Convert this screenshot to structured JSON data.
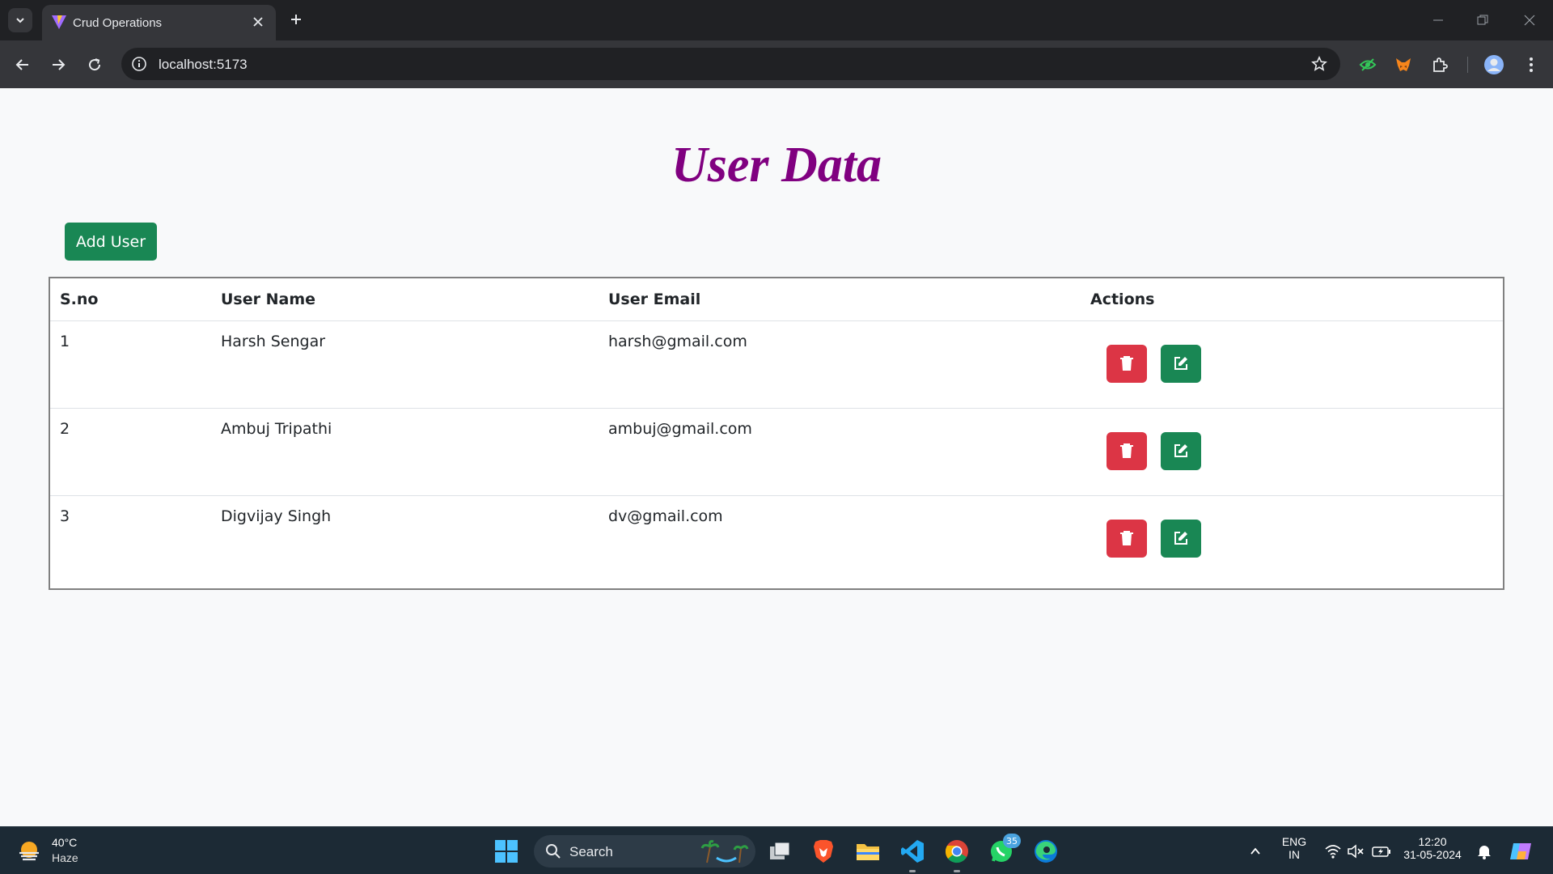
{
  "browser": {
    "tab_title": "Crud Operations",
    "url": "localhost:5173"
  },
  "page": {
    "title": "User Data",
    "add_button": "Add User",
    "table": {
      "headers": [
        "S.no",
        "User Name",
        "User Email",
        "Actions"
      ],
      "rows": [
        {
          "sno": "1",
          "name": "Harsh Sengar",
          "email": "harsh@gmail.com"
        },
        {
          "sno": "2",
          "name": "Ambuj Tripathi",
          "email": "ambuj@gmail.com"
        },
        {
          "sno": "3",
          "name": "Digvijay Singh",
          "email": "dv@gmail.com"
        }
      ]
    }
  },
  "taskbar": {
    "weather_temp": "40°C",
    "weather_desc": "Haze",
    "search_placeholder": "Search",
    "whatsapp_badge": "35",
    "lang_top": "ENG",
    "lang_bottom": "IN",
    "time": "12:20",
    "date": "31-05-2024"
  },
  "colors": {
    "title": "#800080",
    "add_button": "#198754",
    "delete_button": "#dc3545",
    "edit_button": "#198754",
    "taskbar": "#1c2a35"
  }
}
